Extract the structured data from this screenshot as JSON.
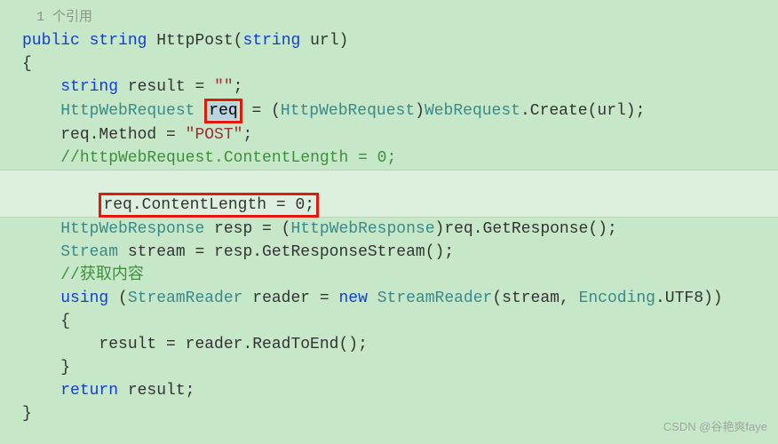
{
  "ref_text": "1 个引用",
  "sig": {
    "public": "public",
    "type1": "string",
    "name": "HttpPost",
    "type2": "string",
    "param": "url"
  },
  "braces": {
    "open": "{",
    "open2": "{",
    "close": "}",
    "close2": "}"
  },
  "l1": {
    "type": "string",
    "var": " result = ",
    "str": "\"\"",
    "semi": ";"
  },
  "l2": {
    "type": "HttpWebRequest",
    "req": "req",
    "eq": " = (",
    "cast": "HttpWebRequest",
    "rp": ")",
    "wr": "WebRequest",
    "dot": ".",
    "create": "Create",
    "lp2": "(url);"
  },
  "l3": {
    "left": "req.Method = ",
    "str": "\"POST\"",
    "semi": ";"
  },
  "l4": {
    "cmt": "//httpWebRequest.ContentLength = 0;"
  },
  "l5": {
    "txt": "req.ContentLength = 0;"
  },
  "l6": {
    "type1": "HttpWebResponse",
    "mid": " resp = (",
    "type2": "HttpWebResponse",
    "rp": ")",
    "rest": "req.GetResponse();"
  },
  "l7": {
    "type": "Stream",
    "rest": " stream = resp.GetResponseStream();"
  },
  "l8": {
    "cmt": "//获取内容"
  },
  "l9": {
    "using": "using",
    "sp": " (",
    "type": "StreamReader",
    "mid": " reader = ",
    "new": "new",
    "sp2": " ",
    "type2": "StreamReader",
    "args": "(stream, ",
    "enc": "Encoding",
    "utf": ".UTF8))"
  },
  "l10": {
    "txt": "result = reader.ReadToEnd();"
  },
  "l11": {
    "ret": "return",
    "rest": " result;"
  },
  "watermark": "CSDN @谷艳爽faye"
}
